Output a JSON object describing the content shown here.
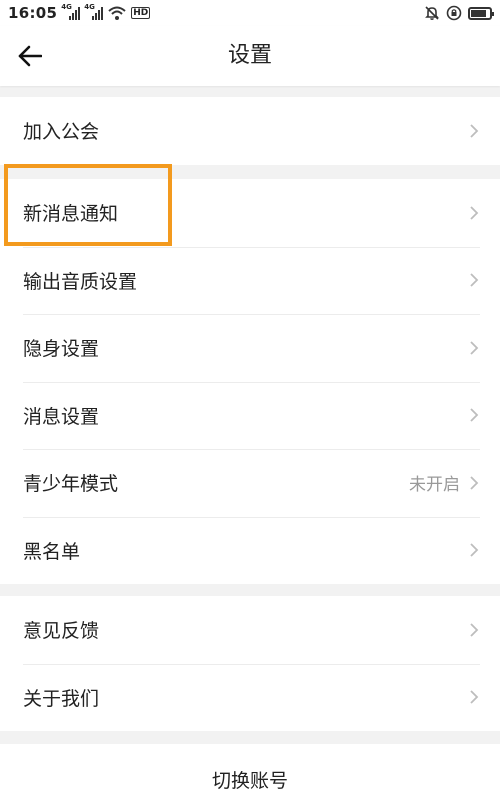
{
  "status_bar": {
    "time": "16:05",
    "signal_tag_1": "4G",
    "signal_tag_2": "4G",
    "hd_badge": "HD"
  },
  "header": {
    "title": "设置"
  },
  "groups": [
    {
      "items": [
        {
          "label": "加入公会"
        }
      ]
    },
    {
      "items": [
        {
          "label": "新消息通知"
        },
        {
          "label": "输出音质设置"
        },
        {
          "label": "隐身设置"
        },
        {
          "label": "消息设置"
        },
        {
          "label": "青少年模式",
          "value": "未开启"
        },
        {
          "label": "黑名单"
        }
      ]
    },
    {
      "items": [
        {
          "label": "意见反馈"
        },
        {
          "label": "关于我们"
        }
      ]
    }
  ],
  "footer": {
    "switch_account_label": "切换账号"
  },
  "colors": {
    "highlight": "#f39a1e",
    "background": "#f2f2f2",
    "secondary_text": "#999999"
  },
  "icons": {
    "back": "arrow-left-icon",
    "chevron": "chevron-right-icon"
  }
}
